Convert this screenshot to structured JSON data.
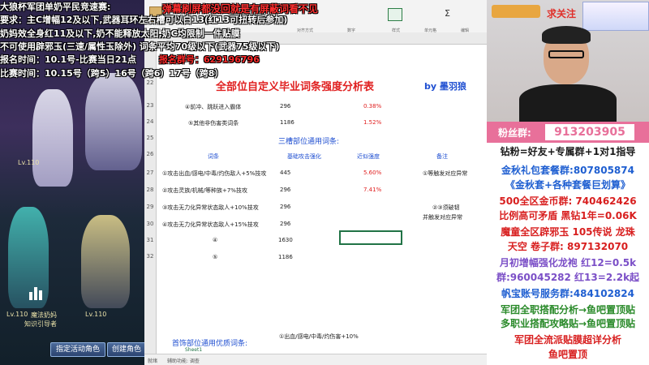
{
  "overlay": {
    "line1": "大狼杯军团单奶平民竞速赛:",
    "line2": "要求：主C增幅12及以下,武器耳环左右槽可以白13(红13可扭转后参加)",
    "line3": "奶妈效全身红11及以下,奶不能释放太阳,奶C均限制一件贴膜",
    "line4": "不可使用辟邪玉(三速/属性玉除外) 词条平均70级以下(武器75级以下)",
    "line5a": "报名时间：10.1号-比赛当日21点",
    "line5b": "报名群号：629196796",
    "line6": "比赛时间：10.15号（跨5）16号（跨6）17号（跨8）"
  },
  "danmu_banner": "弹幕刷屏都没回就是有屏蔽词看不见",
  "game": {
    "lv1": "Lv.110",
    "lv2": "Lv.110",
    "lv3": "Lv.110",
    "name1": "魔法奶妈",
    "name2": "知识引导者",
    "button1": "指定活动角色",
    "button2": "创建角色"
  },
  "sheet": {
    "title": "全部位自定义毕业词条强度分析表",
    "author": "by  墨羽狼",
    "ribbon_labels": [
      "剪贴板",
      "字体",
      "对齐方式",
      "数字",
      "样式",
      "单元格",
      "编辑"
    ],
    "rows": [
      {
        "num": "23",
        "desc": "④前冲、跳跃进入霸体",
        "base": "296",
        "pct": "0.38%"
      },
      {
        "num": "24",
        "desc": "⑤其他非伤害类词条",
        "base": "1186",
        "pct": "1.52%"
      }
    ],
    "section_title": "三槽部位通用词条:",
    "headers": {
      "entry": "词条",
      "base": "基础攻击强化",
      "pct": "近似强度",
      "note": "备注"
    },
    "entries": [
      {
        "num": "27",
        "desc": "①攻击出血/感电/中毒/灼伤敌人+5%技攻",
        "base": "445",
        "pct": "5.60%",
        "note": "①等触发对应异常"
      },
      {
        "num": "28",
        "desc": "②攻击灵族/机械/等种族+7%技攻",
        "base": "296",
        "pct": "7.41%",
        "note": ""
      },
      {
        "num": "29",
        "desc": "③攻击无力化异常状态敌人+10%技攻",
        "base": "296",
        "pct": "",
        "note": "②③须破韧"
      },
      {
        "num": "30",
        "desc": "④攻击无力化异常状态敌人+15%技攻",
        "base": "296",
        "pct": "",
        "note": "并触发对应异常"
      },
      {
        "num": "31",
        "desc": "④",
        "base": "1630",
        "pct": "",
        "note": ""
      },
      {
        "num": "32",
        "desc": "⑤",
        "base": "1186",
        "pct": "",
        "note": ""
      }
    ],
    "row_numbers": [
      "22",
      "23",
      "24",
      "25",
      "26",
      "27",
      "28",
      "29",
      "30",
      "31",
      "32",
      "33",
      "34",
      "35",
      "36",
      "37"
    ],
    "bottom_title": "首饰部位通用优质词条:",
    "bottom_entry": "①出血/感电/中毒/灼伤害+10%",
    "status_left": "就绪",
    "status_mid": "辅助功能: 调查",
    "sheet_tab": "Sheet1"
  },
  "stream": {
    "follow": "求关注",
    "fans_label": "粉丝群:",
    "fans_number": "913203905",
    "lines": [
      {
        "text": "钻粉=好友+专属群+1对1指导",
        "color": "#1a1a1a"
      },
      {
        "text": "金秋礼包套餐群:807805874",
        "color": "#1f5fd1"
      },
      {
        "text": "《金秋套+各种套餐巨划算》",
        "color": "#1f5fd1"
      },
      {
        "text": "500全区金币群: 740462426",
        "color": "#d81f1f"
      },
      {
        "text": "比例高可矛盾  黑钻1年=0.06K",
        "color": "#d81f1f"
      },
      {
        "text": "魔童全区辟邪玉 105传说 龙珠",
        "color": "#d81f1f"
      },
      {
        "text": "天空 卷子群: 897132070",
        "color": "#d81f1f"
      },
      {
        "text": "月初增幅强化龙袍 红12=0.5k",
        "color": "#7b4fc7"
      },
      {
        "text": "群:960045282  红13=2.2k起",
        "color": "#7b4fc7"
      },
      {
        "text": "帆宝账号服务群:484102824",
        "color": "#1f5fd1"
      },
      {
        "text": "军团全职搭配分析→鱼吧置顶贴",
        "color": "#2a8a2a"
      },
      {
        "text": "多职业搭配攻略贴→鱼吧置顶贴",
        "color": "#2a8a2a"
      },
      {
        "text": "军团全流派贴膜超详分析",
        "color": "#d81f1f"
      },
      {
        "text": "鱼吧置顶",
        "color": "#d81f1f"
      }
    ]
  }
}
